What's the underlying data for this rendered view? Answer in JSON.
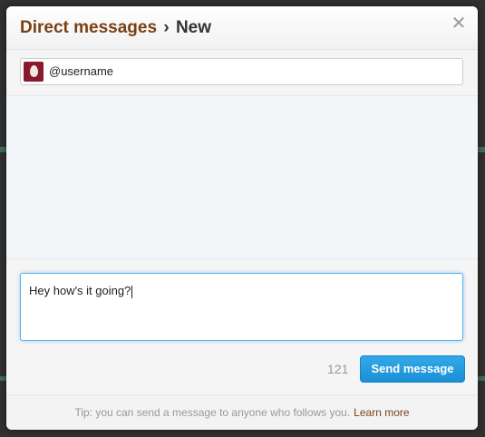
{
  "dialog": {
    "title_section": "Direct messages",
    "title_separator": "›",
    "title_page": "New",
    "close_glyph": "✕"
  },
  "recipient": {
    "value": "@username"
  },
  "compose": {
    "text": "Hey how's it going?",
    "chars_remaining": "121",
    "send_label": "Send message"
  },
  "footer": {
    "tip": "Tip: you can send a message to anyone who follows you.",
    "learn_more": "Learn more"
  },
  "colors": {
    "title_link": "#7b3f13",
    "send_button": "#1a8fd4",
    "focus_ring": "#56b4ef"
  },
  "icons": {
    "close": "close-icon",
    "avatar": "default-egg-avatar"
  }
}
